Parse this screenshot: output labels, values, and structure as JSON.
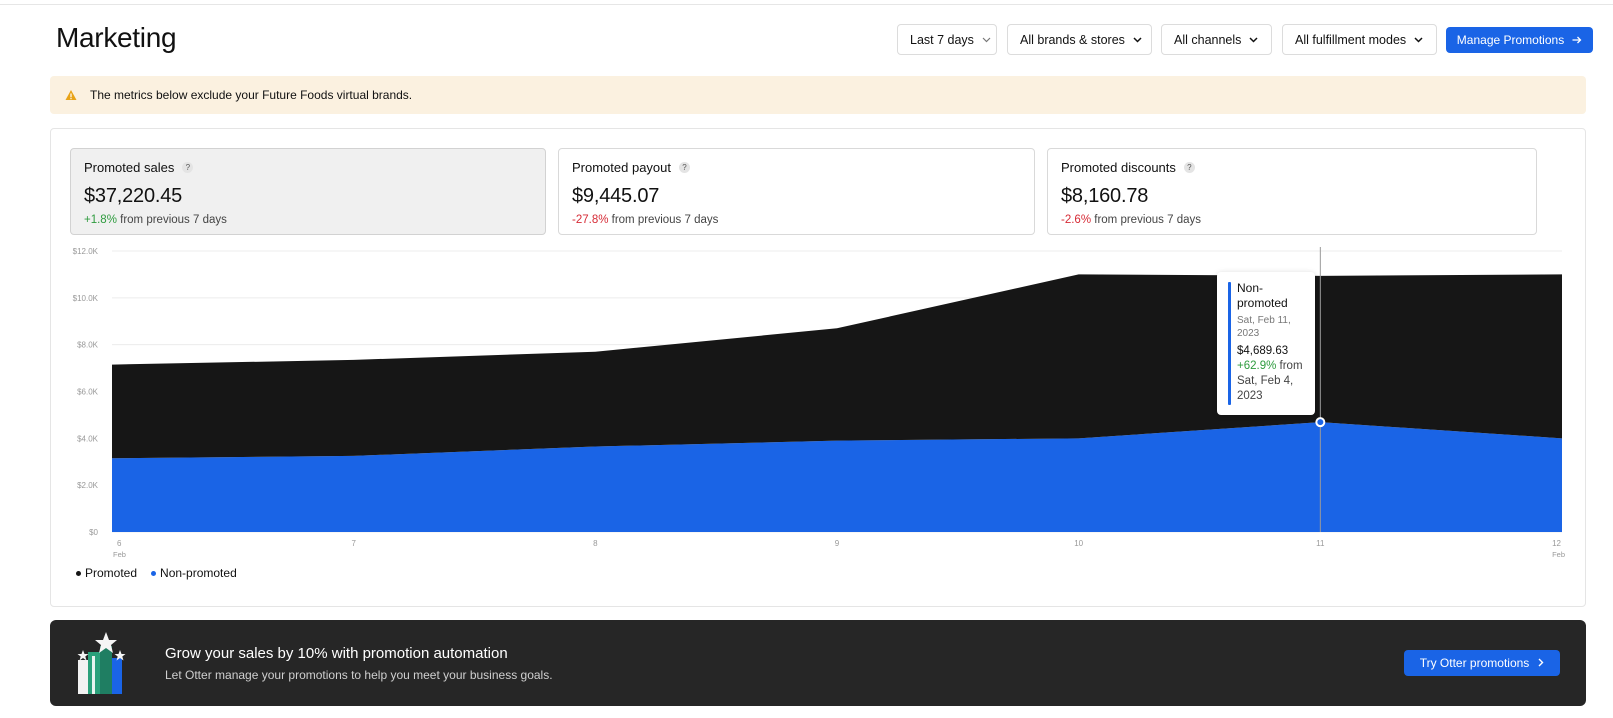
{
  "header": {
    "title": "Marketing",
    "filters": {
      "date_range": "Last 7 days",
      "brands": "All brands & stores",
      "channels": "All channels",
      "fulfillment": "All fulfillment modes"
    },
    "manage_button": "Manage Promotions"
  },
  "banner": {
    "text": "The metrics below exclude your Future Foods virtual brands.",
    "icon": "warning-icon"
  },
  "metrics": [
    {
      "label": "Promoted sales",
      "value": "$37,220.45",
      "change": "+1.8%",
      "change_suffix": "from previous 7 days",
      "direction": "up"
    },
    {
      "label": "Promoted payout",
      "value": "$9,445.07",
      "change": "-27.8%",
      "change_suffix": "from previous 7 days",
      "direction": "down"
    },
    {
      "label": "Promoted discounts",
      "value": "$8,160.78",
      "change": "-2.6%",
      "change_suffix": "from previous 7 days",
      "direction": "down"
    }
  ],
  "chart_data": {
    "type": "area",
    "stacked": true,
    "x": [
      "6",
      "7",
      "8",
      "9",
      "10",
      "11",
      "12"
    ],
    "x_sublabels": [
      "Feb",
      "",
      "",
      "",
      "",
      "",
      "Feb"
    ],
    "y_ticks": [
      "$0",
      "$2.0K",
      "$4.0K",
      "$6.0K",
      "$8.0K",
      "$10.0K",
      "$12.0K"
    ],
    "ylim": [
      0,
      12000
    ],
    "series": [
      {
        "name": "Non-promoted",
        "color": "#1a64e6",
        "values": [
          3150,
          3250,
          3650,
          3900,
          4000,
          4690,
          4000
        ]
      },
      {
        "name": "Promoted",
        "color": "#161616",
        "values": [
          4000,
          4100,
          4050,
          4800,
          7000,
          6250,
          7000
        ]
      }
    ],
    "grid": true,
    "legend_position": "bottom-left"
  },
  "legend": [
    {
      "label": "Promoted",
      "color": "#161616"
    },
    {
      "label": "Non-promoted",
      "color": "#1a64e6"
    }
  ],
  "tooltip": {
    "series": "Non-promoted",
    "date": "Sat, Feb 11, 2023",
    "value": "$4,689.63",
    "change": "+62.9%",
    "change_suffix": "from Sat, Feb 4, 2023"
  },
  "promo_banner": {
    "title": "Grow your sales by 10% with promotion automation",
    "subtitle": "Let Otter manage your promotions to help you meet your business goals.",
    "button": "Try Otter promotions"
  },
  "colors": {
    "accent": "#1a64e6",
    "positive": "#2e9b3e",
    "negative": "#d62b36",
    "banner_bg": "#fbf1e0"
  }
}
